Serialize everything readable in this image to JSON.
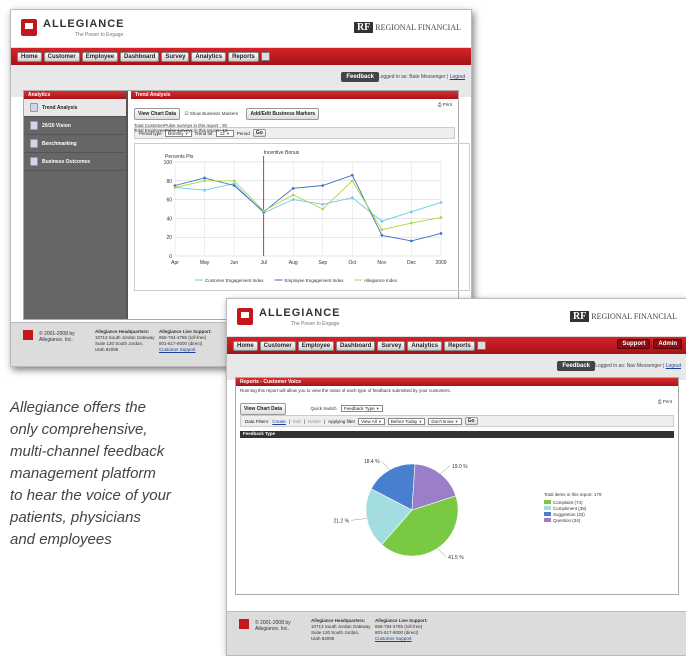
{
  "caption": [
    "Allegiance offers the",
    "only comprehensive,",
    "multi-channel feedback",
    "management platform",
    "to hear the voice of your",
    "patients, physicians",
    "and employees"
  ],
  "app": {
    "brand": "ALLEGIANCE",
    "tagline": "The Power to Engage",
    "partner_mark": "RF",
    "partner_name": "REGIONAL FINANCIAL",
    "nav": [
      "Home",
      "Customer",
      "Employee",
      "Dashboard",
      "Survey",
      "Analytics",
      "Reports"
    ],
    "nav_right": [
      "Support",
      "Admin"
    ],
    "feedback": "Feedback",
    "logged_in_1": "Logged in as: Bate Messenger",
    "logged_in_2": "Logged in as: Nav Messenger",
    "logout": "Logout"
  },
  "w1": {
    "section": "Analytics",
    "sidebar": [
      "Trend Analysis",
      "20/20 Vision",
      "Benchmarking",
      "Business Outcomes"
    ],
    "panel": "Trend Analysis",
    "view_chart": "View Chart Data",
    "show_markers": "Show Business Markers",
    "add_markers": "Add/Edit Business Markers",
    "print": "Print",
    "stat1": "Total CustomerPulse surveys in this report : 30",
    "stat2": "Total EmployeePulse surveys in this report : 12",
    "period_label": "Period type",
    "period_val": "Monthly",
    "trend_label": "Trend for",
    "trend_val": "12",
    "period2": "Period",
    "go": "Go"
  },
  "w2": {
    "panel": "Reports - Customer Voice",
    "desc": "Running this report will allow you to view the ratios of each type of feedback submitted by your customers.",
    "view_chart": "View Chart Data",
    "quick_switch": "Quick Switch",
    "quick_val": "Feedback Type",
    "print": "Print",
    "filters": "Data Filters:",
    "create": "Create",
    "edit": "Edit",
    "delete": "Delete",
    "applying": "Applying filter",
    "view_all": "View All",
    "before": "Before Today",
    "dont_know": "Don't know",
    "go": "Go",
    "chart_title": "Feedback Type"
  },
  "footer": {
    "copy": "© 2001-2008 by Allegiance, Inc.",
    "hq_title": "Allegiance Headquarters:",
    "hq_lines": [
      "10713 South Jordan Gateway",
      "Suite 120 South Jordan,",
      "Utah 84095"
    ],
    "ls_title": "Allegiance Live Support:",
    "ls_lines": [
      "866-794-4785 (toll-free)",
      "801-617-8000 (direct)"
    ],
    "ls_link": "Customer Support"
  },
  "chart_data": [
    {
      "type": "line",
      "categories": [
        "Apr",
        "May",
        "Jun",
        "Jul",
        "Aug",
        "Sep",
        "Oct",
        "Nov",
        "Dec",
        "2009"
      ],
      "ylabel": "Percents Pts",
      "ylim": [
        0,
        100
      ],
      "yticks": [
        0,
        20,
        40,
        60,
        80,
        100
      ],
      "annotation": "Incentive Bonus",
      "annotation_x": "Jul",
      "series": [
        {
          "name": "Customer Engagement Index",
          "color": "#6fc8e8",
          "values": [
            73,
            70,
            77,
            46,
            60,
            55,
            62,
            37,
            47,
            57
          ]
        },
        {
          "name": "Employee Engagement Index",
          "color": "#3b6fc2",
          "values": [
            75,
            83,
            75,
            47,
            72,
            75,
            86,
            22,
            16,
            24
          ]
        },
        {
          "name": "Allegiance Index",
          "color": "#a7d83c",
          "values": [
            73,
            80,
            80,
            48,
            65,
            50,
            80,
            28,
            35,
            41
          ]
        }
      ]
    },
    {
      "type": "pie",
      "legend_title": "Total items in this report: 179",
      "slices": [
        {
          "label": "Complaint (74)",
          "value": 41.5,
          "color": "#7ac943",
          "pct_label": "41.5 %"
        },
        {
          "label": "Compliment (38)",
          "value": 21.2,
          "color": "#a3dde0",
          "pct_label": "21.2 %"
        },
        {
          "label": "Suggestion (33)",
          "value": 18.4,
          "color": "#4a7fd0",
          "pct_label": "18.4 %"
        },
        {
          "label": "Question (34)",
          "value": 19.0,
          "color": "#9b7ec8",
          "pct_label": "19.0 %"
        }
      ]
    }
  ]
}
